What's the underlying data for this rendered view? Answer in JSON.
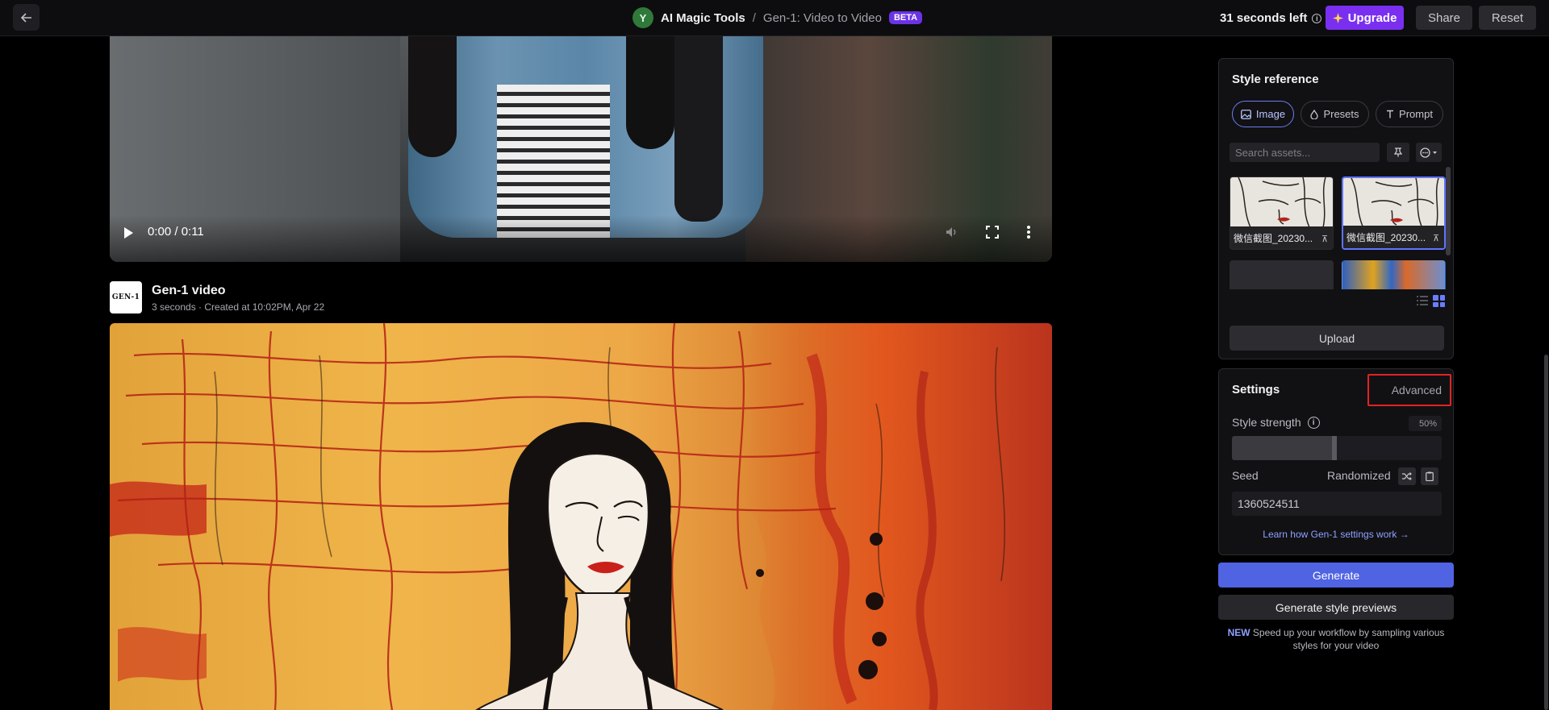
{
  "header": {
    "avatar_initial": "Y",
    "app_name": "AI Magic Tools",
    "separator": "/",
    "page_name": "Gen-1: Video to Video",
    "beta_badge": "BETA",
    "time_left": "31 seconds left",
    "upgrade_label": "Upgrade",
    "share_label": "Share",
    "reset_label": "Reset"
  },
  "source_video": {
    "time_display": "0:00 / 0:11",
    "progress": 0.02
  },
  "output": {
    "logo_text": "GEN-1",
    "title": "Gen-1 video",
    "subtitle": "3 seconds · Created at 10:02PM, Apr 22"
  },
  "style_reference": {
    "title": "Style reference",
    "tabs": [
      {
        "label": "Image",
        "icon": "image-icon",
        "active": true
      },
      {
        "label": "Presets",
        "icon": "droplet-icon",
        "active": false
      },
      {
        "label": "Prompt",
        "icon": "text-icon",
        "active": false
      }
    ],
    "search_placeholder": "Search assets...",
    "assets": [
      {
        "caption": "微信截图_20230...",
        "selected": false
      },
      {
        "caption": "微信截图_20230...",
        "selected": true
      }
    ],
    "upload_label": "Upload"
  },
  "settings": {
    "title": "Settings",
    "advanced_label": "Advanced",
    "style_strength_label": "Style strength",
    "style_strength_value": "50%",
    "style_strength": 0.5,
    "seed_label": "Seed",
    "randomized_label": "Randomized",
    "seed_value": "1360524511",
    "learn_link": "Learn how Gen-1 settings work →"
  },
  "actions": {
    "generate_label": "Generate",
    "preview_label": "Generate style previews",
    "promo_new": "NEW",
    "promo_text": " Speed up your workflow by sampling various styles for your video"
  },
  "colors": {
    "accent": "#4f63e3",
    "upgrade": "#7a2ff0",
    "beta": "#6b33e6",
    "highlight_box": "#e02424"
  }
}
